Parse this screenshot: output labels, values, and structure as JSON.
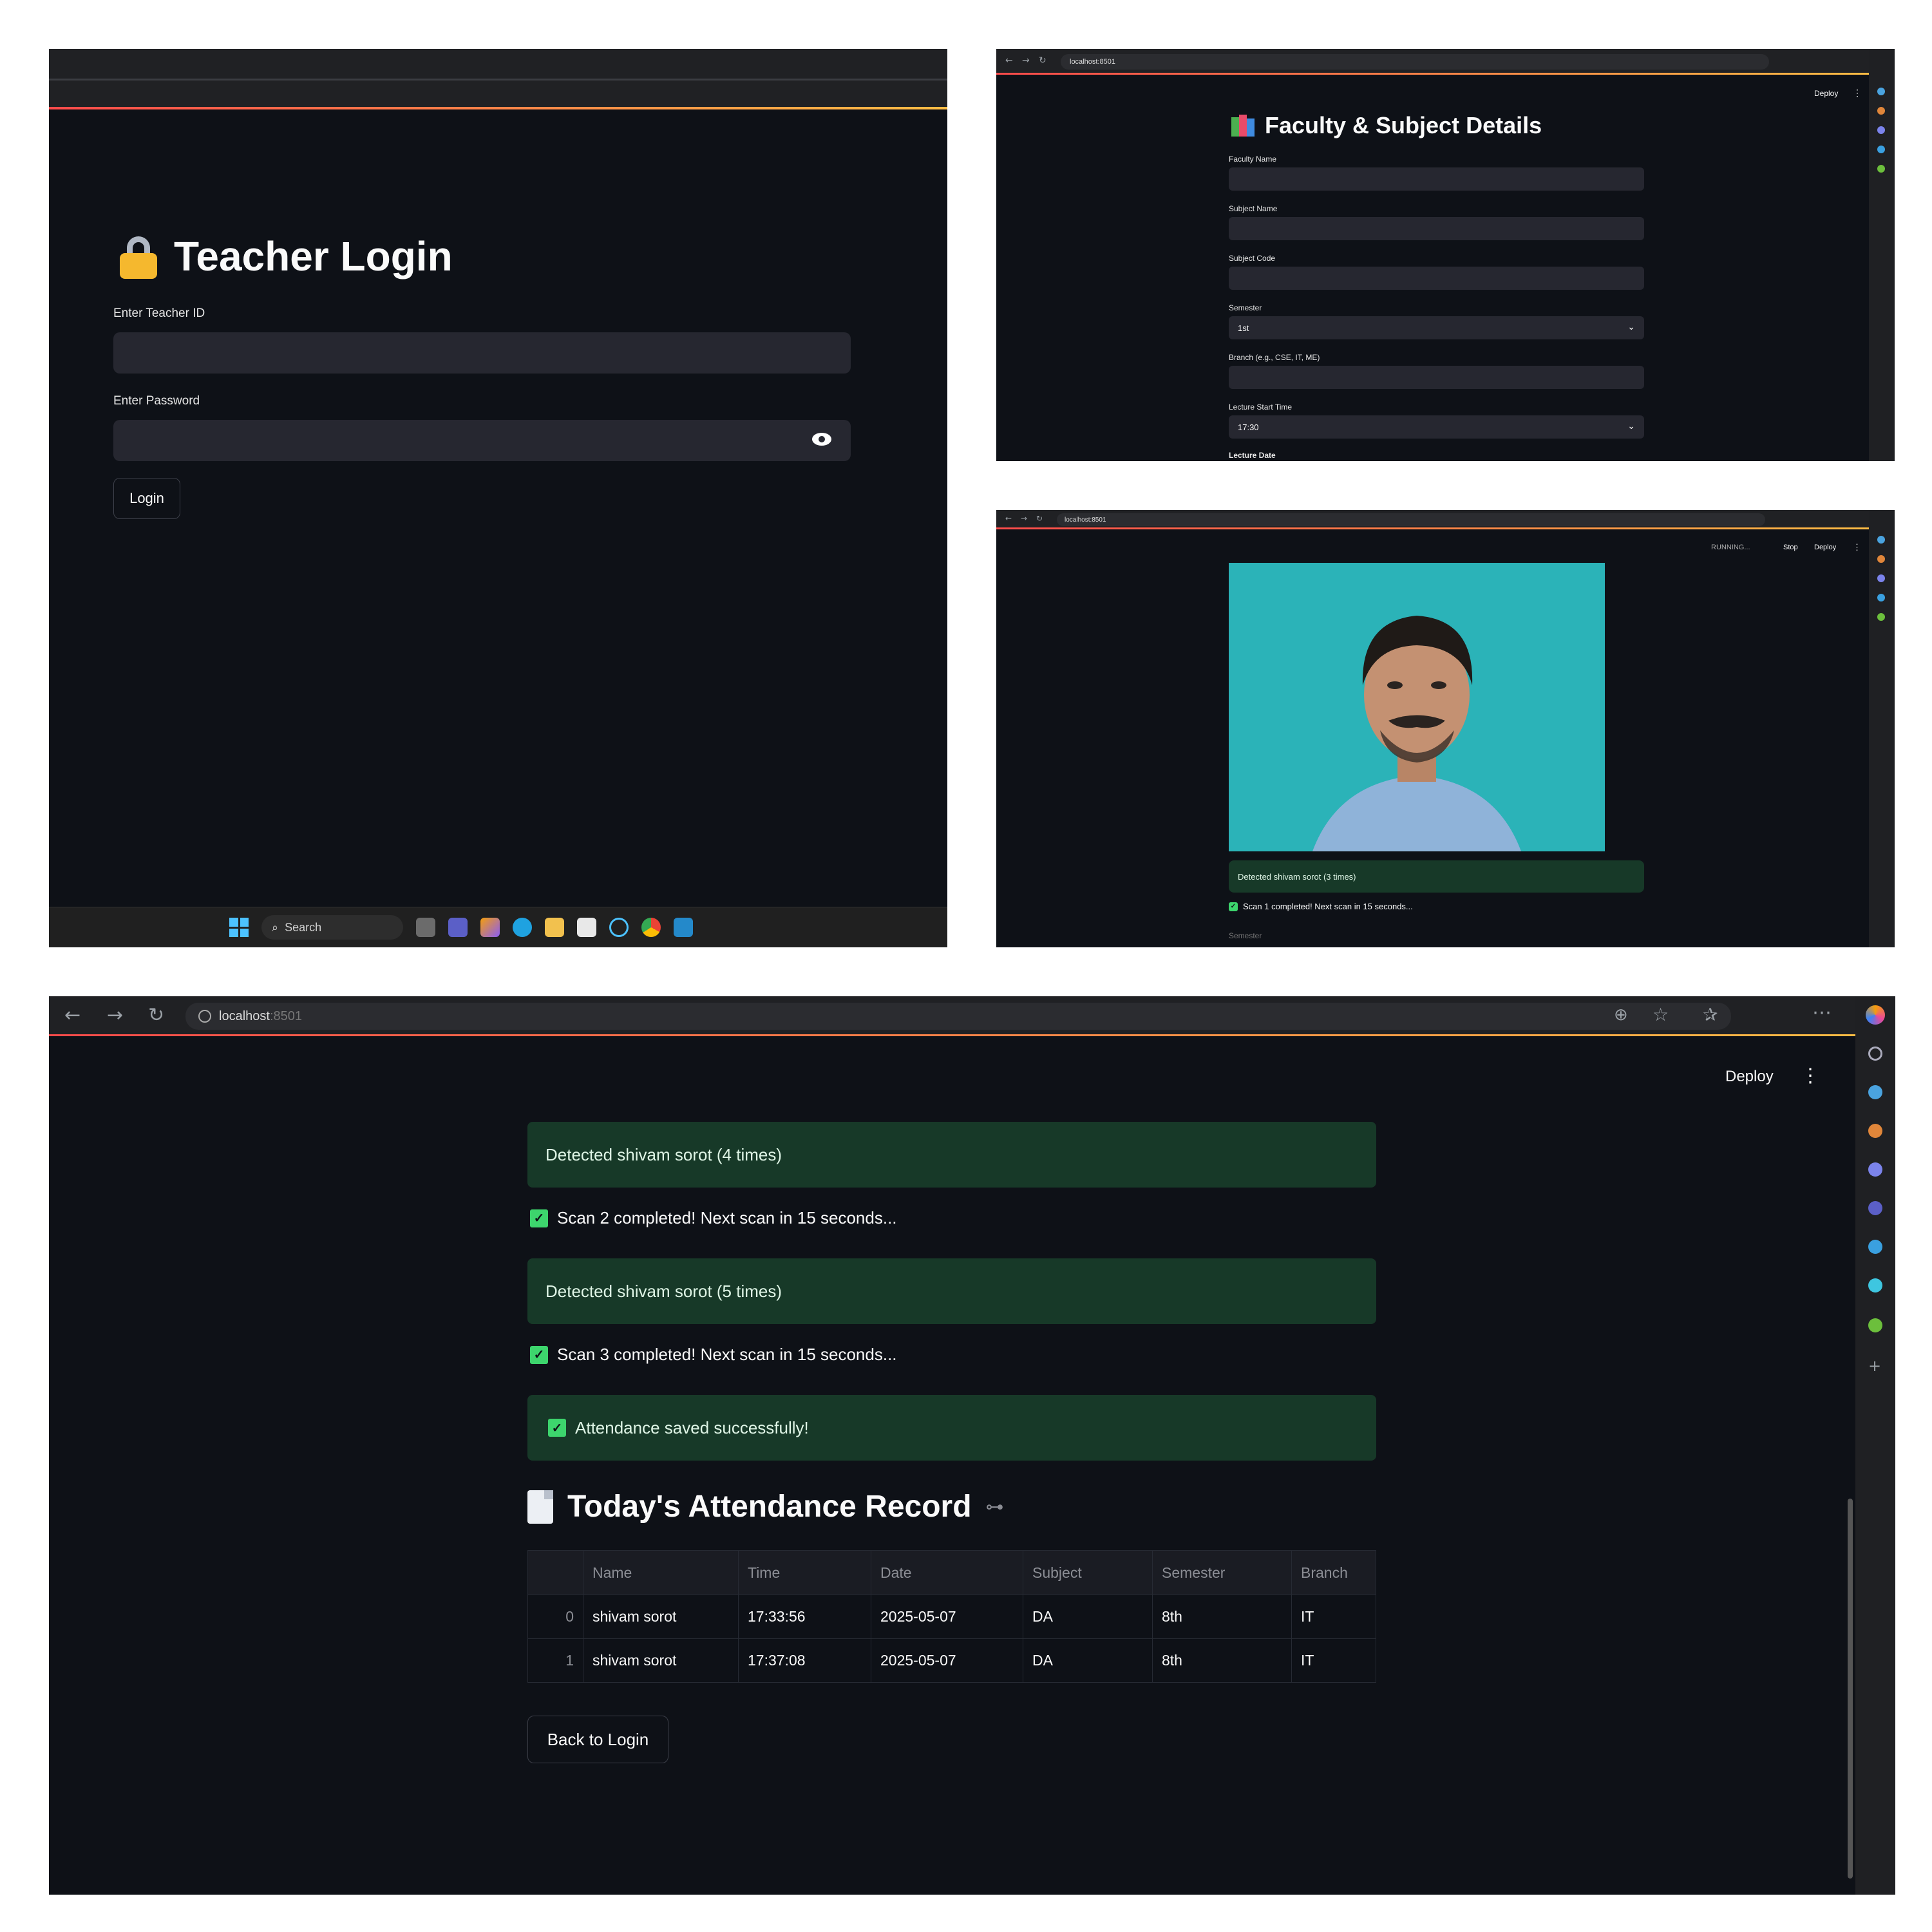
{
  "login": {
    "title": "Teacher Login",
    "teacher_id_label": "Enter Teacher ID",
    "password_label": "Enter Password",
    "login_button": "Login",
    "taskbar_search": "Search"
  },
  "faculty": {
    "url": "localhost:8501",
    "deploy": "Deploy",
    "title": "Faculty & Subject Details",
    "fields": [
      {
        "label": "Faculty Name",
        "value": ""
      },
      {
        "label": "Subject Name",
        "value": ""
      },
      {
        "label": "Subject Code",
        "value": ""
      },
      {
        "label": "Semester",
        "value": "1st"
      },
      {
        "label": "Branch (e.g., CSE, IT, ME)",
        "value": ""
      },
      {
        "label": "Lecture Start Time",
        "value": "17:30"
      }
    ],
    "next_label": "Lecture Date"
  },
  "scan": {
    "url": "localhost:8501",
    "running": "RUNNING...",
    "stop": "Stop",
    "deploy": "Deploy",
    "detected": "Detected shivam sorot (3 times)",
    "scan_msg": "Scan 1 completed! Next scan in 15 seconds...",
    "next_label": "Semester"
  },
  "record": {
    "url_host": "localhost",
    "url_port": ":8501",
    "deploy": "Deploy",
    "detected_1": "Detected shivam sorot (4 times)",
    "scan_2": "Scan 2 completed! Next scan in 15 seconds...",
    "detected_2": "Detected shivam sorot (5 times)",
    "scan_3": "Scan 3 completed! Next scan in 15 seconds...",
    "saved": "Attendance saved successfully!",
    "heading": "Today's Attendance Record",
    "table": {
      "columns": [
        "Name",
        "Time",
        "Date",
        "Subject",
        "Semester",
        "Branch"
      ],
      "rows": [
        {
          "index": "0",
          "cells": [
            "shivam sorot",
            "17:33:56",
            "2025-05-07",
            "DA",
            "8th",
            "IT"
          ]
        },
        {
          "index": "1",
          "cells": [
            "shivam sorot",
            "17:37:08",
            "2025-05-07",
            "DA",
            "8th",
            "IT"
          ]
        }
      ]
    },
    "back_button": "Back to Login"
  },
  "colors": {
    "app_bg": "#0e1117",
    "input_bg": "#262730",
    "success_bg": "#173928",
    "check_green": "#3dd56d",
    "accent_red": "#ff4b4b"
  }
}
